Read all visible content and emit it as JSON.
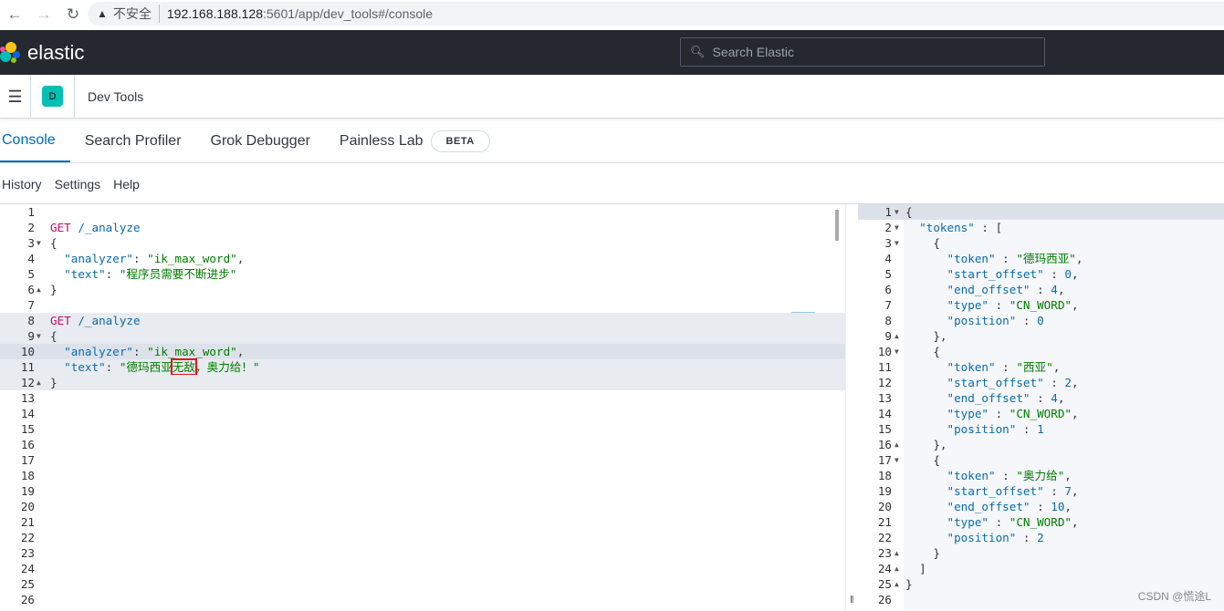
{
  "browser": {
    "back_icon": "arrow-left",
    "forward_icon": "arrow-right",
    "reload_icon": "reload",
    "security_label": "不安全",
    "url_host": "192.168.188.128",
    "url_rest": ":5601/app/dev_tools#/console"
  },
  "header": {
    "brand": "elastic",
    "search_placeholder": "Search Elastic"
  },
  "breadcrumb": {
    "avatar_letter": "D",
    "title": "Dev Tools"
  },
  "tabs": [
    {
      "label": "Console",
      "active": true
    },
    {
      "label": "Search Profiler"
    },
    {
      "label": "Grok Debugger"
    },
    {
      "label": "Painless Lab",
      "badge": "BETA"
    }
  ],
  "toolbar": {
    "history": "History",
    "settings": "Settings",
    "help": "Help"
  },
  "editor": {
    "highlighted_lines": [
      8,
      9,
      10,
      11,
      12
    ],
    "cursor_line": 10,
    "fold_lines": {
      "3": "down",
      "6": "up",
      "9": "down",
      "12": "up"
    },
    "lines": [
      [],
      [
        [
          "kw",
          "GET"
        ],
        [
          "pun",
          " "
        ],
        [
          "path",
          "/_analyze"
        ]
      ],
      [
        [
          "pun",
          "{"
        ]
      ],
      [
        [
          "pun",
          "  "
        ],
        [
          "key",
          "\"analyzer\""
        ],
        [
          "pun",
          ": "
        ],
        [
          "str",
          "\"ik_max_word\""
        ],
        [
          "pun",
          ","
        ]
      ],
      [
        [
          "pun",
          "  "
        ],
        [
          "key",
          "\"text\""
        ],
        [
          "pun",
          ": "
        ],
        [
          "str",
          "\"程序员需要不断进步\""
        ]
      ],
      [
        [
          "pun",
          "}"
        ]
      ],
      [],
      [
        [
          "kw",
          "GET"
        ],
        [
          "pun",
          " "
        ],
        [
          "path",
          "/_analyze"
        ]
      ],
      [
        [
          "pun",
          "{"
        ]
      ],
      [
        [
          "pun",
          "  "
        ],
        [
          "key",
          "\"analyzer\""
        ],
        [
          "pun",
          ": "
        ],
        [
          "str",
          "\"ik_max_word\""
        ],
        [
          "pun",
          ","
        ]
      ],
      [
        [
          "pun",
          "  "
        ],
        [
          "key",
          "\"text\""
        ],
        [
          "pun",
          ": "
        ],
        [
          "str",
          "\"德玛西亚"
        ],
        [
          "str-box",
          "无敌"
        ],
        [
          "str",
          "，奥力给！\""
        ]
      ],
      [
        [
          "pun",
          "}"
        ]
      ],
      [],
      [],
      [],
      [],
      [],
      [],
      [],
      [],
      [],
      [],
      [],
      [],
      [],
      []
    ]
  },
  "output": {
    "fold_lines": {
      "1": "down",
      "2": "down",
      "3": "down",
      "9": "up",
      "10": "down",
      "16": "up",
      "17": "down",
      "23": "up",
      "24": "up",
      "25": "up"
    },
    "lines": [
      [
        [
          "pun",
          "{"
        ]
      ],
      [
        [
          "pun",
          "  "
        ],
        [
          "key",
          "\"tokens\""
        ],
        [
          "pun",
          " : ["
        ]
      ],
      [
        [
          "pun",
          "    {"
        ]
      ],
      [
        [
          "pun",
          "      "
        ],
        [
          "key",
          "\"token\""
        ],
        [
          "pun",
          " : "
        ],
        [
          "str",
          "\"德玛西亚\""
        ],
        [
          "pun",
          ","
        ]
      ],
      [
        [
          "pun",
          "      "
        ],
        [
          "key",
          "\"start_offset\""
        ],
        [
          "pun",
          " : "
        ],
        [
          "num",
          "0"
        ],
        [
          "pun",
          ","
        ]
      ],
      [
        [
          "pun",
          "      "
        ],
        [
          "key",
          "\"end_offset\""
        ],
        [
          "pun",
          " : "
        ],
        [
          "num",
          "4"
        ],
        [
          "pun",
          ","
        ]
      ],
      [
        [
          "pun",
          "      "
        ],
        [
          "key",
          "\"type\""
        ],
        [
          "pun",
          " : "
        ],
        [
          "str",
          "\"CN_WORD\""
        ],
        [
          "pun",
          ","
        ]
      ],
      [
        [
          "pun",
          "      "
        ],
        [
          "key",
          "\"position\""
        ],
        [
          "pun",
          " : "
        ],
        [
          "num",
          "0"
        ]
      ],
      [
        [
          "pun",
          "    },"
        ]
      ],
      [
        [
          "pun",
          "    {"
        ]
      ],
      [
        [
          "pun",
          "      "
        ],
        [
          "key",
          "\"token\""
        ],
        [
          "pun",
          " : "
        ],
        [
          "str",
          "\"西亚\""
        ],
        [
          "pun",
          ","
        ]
      ],
      [
        [
          "pun",
          "      "
        ],
        [
          "key",
          "\"start_offset\""
        ],
        [
          "pun",
          " : "
        ],
        [
          "num",
          "2"
        ],
        [
          "pun",
          ","
        ]
      ],
      [
        [
          "pun",
          "      "
        ],
        [
          "key",
          "\"end_offset\""
        ],
        [
          "pun",
          " : "
        ],
        [
          "num",
          "4"
        ],
        [
          "pun",
          ","
        ]
      ],
      [
        [
          "pun",
          "      "
        ],
        [
          "key",
          "\"type\""
        ],
        [
          "pun",
          " : "
        ],
        [
          "str",
          "\"CN_WORD\""
        ],
        [
          "pun",
          ","
        ]
      ],
      [
        [
          "pun",
          "      "
        ],
        [
          "key",
          "\"position\""
        ],
        [
          "pun",
          " : "
        ],
        [
          "num",
          "1"
        ]
      ],
      [
        [
          "pun",
          "    },"
        ]
      ],
      [
        [
          "pun",
          "    {"
        ]
      ],
      [
        [
          "pun",
          "      "
        ],
        [
          "key",
          "\"token\""
        ],
        [
          "pun",
          " : "
        ],
        [
          "str",
          "\"奥力给\""
        ],
        [
          "pun",
          ","
        ]
      ],
      [
        [
          "pun",
          "      "
        ],
        [
          "key",
          "\"start_offset\""
        ],
        [
          "pun",
          " : "
        ],
        [
          "num",
          "7"
        ],
        [
          "pun",
          ","
        ]
      ],
      [
        [
          "pun",
          "      "
        ],
        [
          "key",
          "\"end_offset\""
        ],
        [
          "pun",
          " : "
        ],
        [
          "num",
          "10"
        ],
        [
          "pun",
          ","
        ]
      ],
      [
        [
          "pun",
          "      "
        ],
        [
          "key",
          "\"type\""
        ],
        [
          "pun",
          " : "
        ],
        [
          "str",
          "\"CN_WORD\""
        ],
        [
          "pun",
          ","
        ]
      ],
      [
        [
          "pun",
          "      "
        ],
        [
          "key",
          "\"position\""
        ],
        [
          "pun",
          " : "
        ],
        [
          "num",
          "2"
        ]
      ],
      [
        [
          "pun",
          "    }"
        ]
      ],
      [
        [
          "pun",
          "  ]"
        ]
      ],
      [
        [
          "pun",
          "}"
        ]
      ],
      []
    ]
  },
  "watermark": "CSDN @慌途L"
}
